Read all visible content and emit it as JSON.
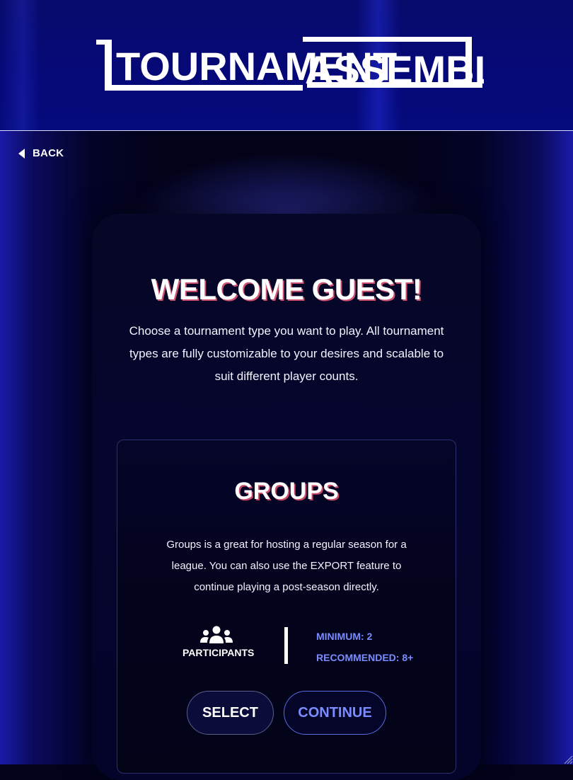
{
  "header": {
    "logo_text_1": "TOURNAMENT",
    "logo_text_2": "ASSEMBLY"
  },
  "nav": {
    "back_label": "BACK"
  },
  "welcome": {
    "title": "WELCOME GUEST!",
    "intro": "Choose a tournament type you want to play. All tournament types are fully customizable to your desires and scalable to suit different player counts."
  },
  "card": {
    "title": "GROUPS",
    "description": "Groups is a great for hosting a regular season for a league. You can also use the EXPORT feature to continue playing a post-season directly.",
    "participants_label": "PARTICIPANTS",
    "minimum": "MINIMUM: 2",
    "recommended": "RECOMMENDED: 8+",
    "select_label": "SELECT",
    "continue_label": "CONTINUE"
  },
  "icons": {
    "back": "caret-left-icon",
    "participants": "users-icon"
  },
  "colors": {
    "header_bg": "#05087a",
    "accent_blue": "#7b8cff",
    "text": "#ffffff"
  }
}
